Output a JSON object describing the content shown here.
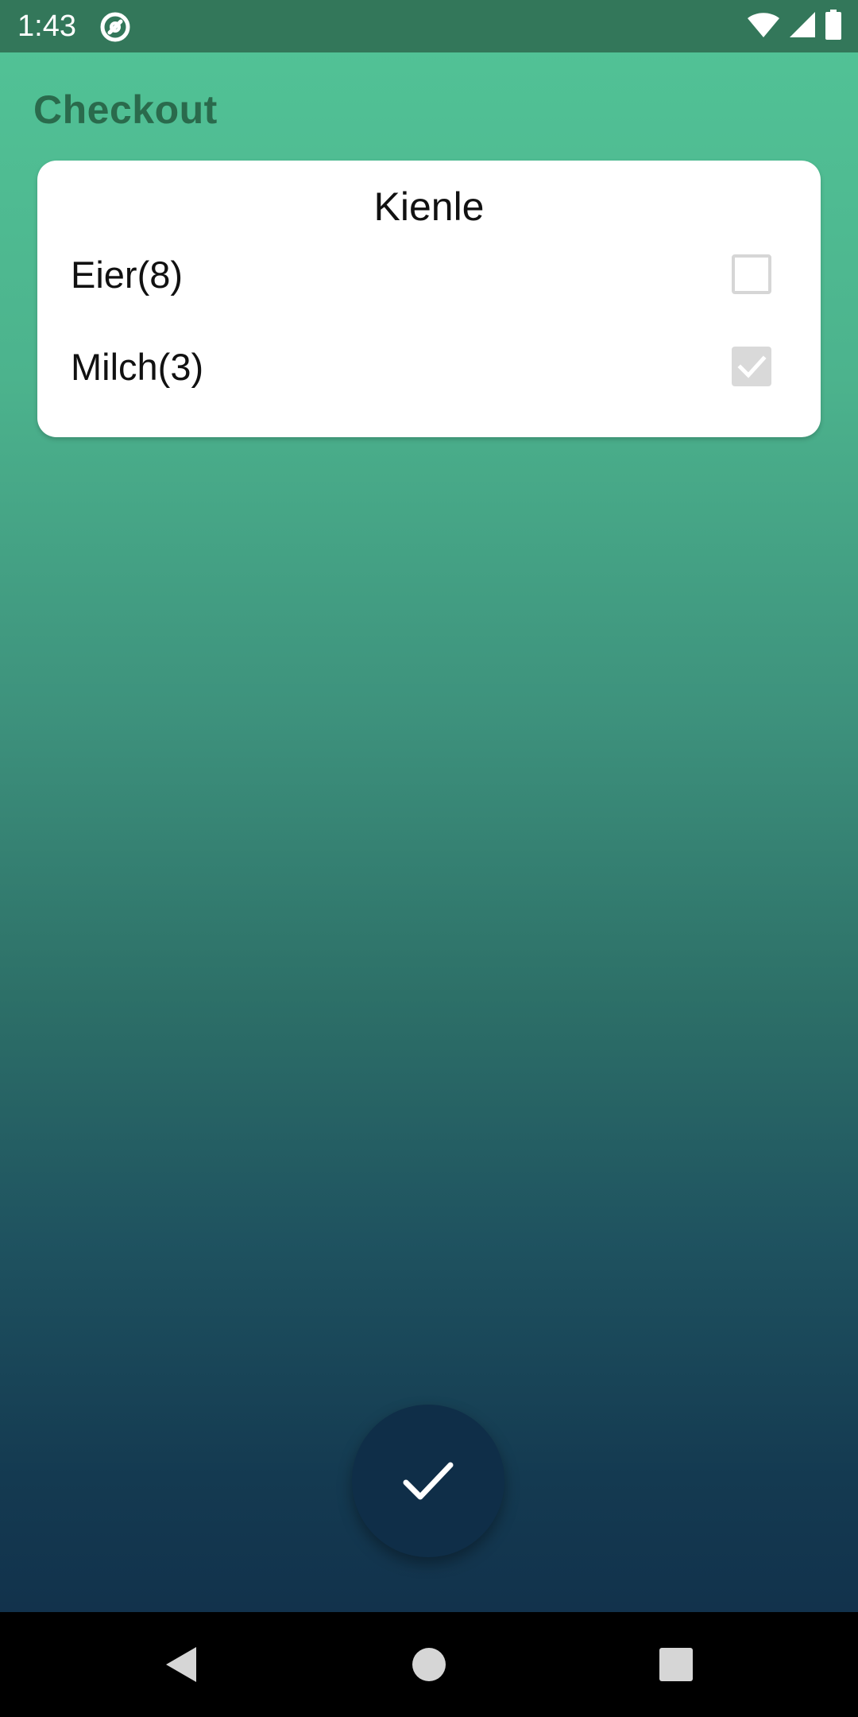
{
  "status_bar": {
    "time": "1:43",
    "app_icon": "at-sign-icon",
    "icons": [
      "wifi-icon",
      "cellular-signal-icon",
      "battery-icon"
    ]
  },
  "header": {
    "title": "Checkout"
  },
  "card": {
    "title": "Kienle",
    "items": [
      {
        "label": "Eier(8)",
        "checked": false
      },
      {
        "label": "Milch(3)",
        "checked": true
      }
    ]
  },
  "fab": {
    "icon": "checkmark-icon"
  },
  "nav_bar": {
    "buttons": [
      "back-icon",
      "home-icon",
      "recents-icon"
    ]
  },
  "colors": {
    "status_bar": "#33775a",
    "title": "#2a6a4c",
    "gradient_top": "#52c497",
    "gradient_bottom": "#102c48",
    "fab": "#0f2e48"
  }
}
